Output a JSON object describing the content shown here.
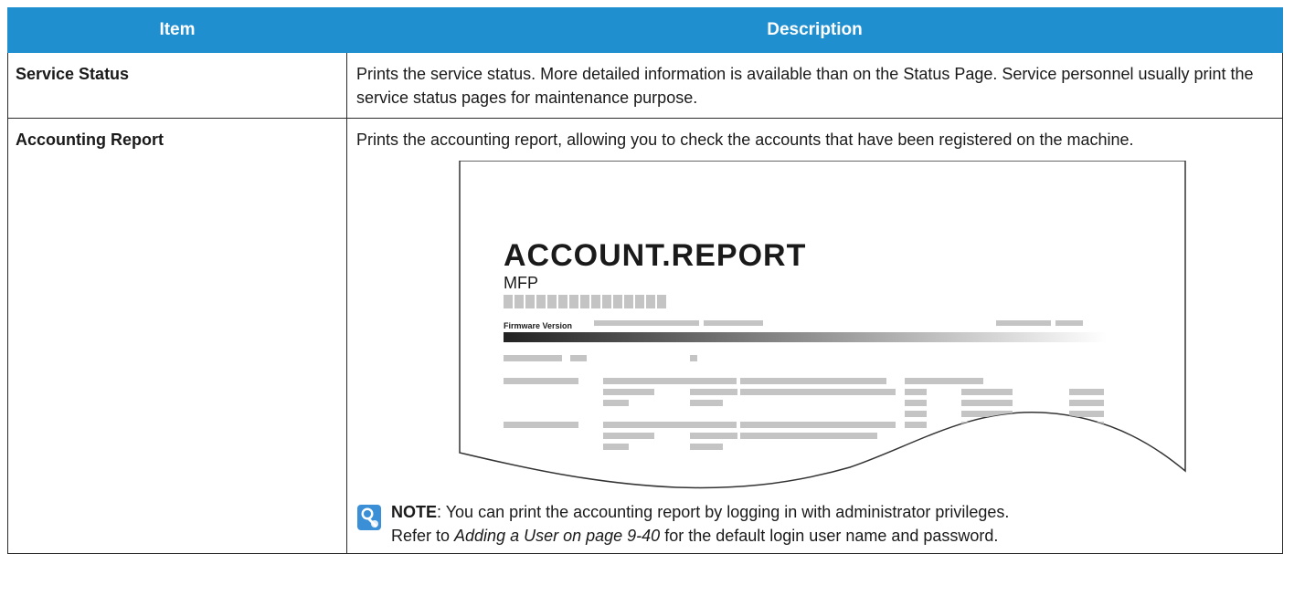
{
  "table": {
    "header": {
      "item": "Item",
      "description": "Description"
    },
    "rows": [
      {
        "item": "Service Status",
        "description": "Prints the service status. More detailed information is available than on the Status Page. Service personnel usually print the service status pages for maintenance purpose."
      },
      {
        "item": "Accounting Report",
        "description": "Prints the accounting report, allowing you to check the accounts that have been registered on the machine."
      }
    ]
  },
  "report": {
    "title": "ACCOUNT.REPORT",
    "subtitle": "MFP",
    "firmware_label": "Firmware Version"
  },
  "note": {
    "label": "NOTE",
    "line1_rest": ": You can print the accounting report by logging in with administrator privileges.",
    "line2_prefix": "Refer to ",
    "line2_link": "Adding a User on page 9-40",
    "line2_suffix": " for the default login user name and password.",
    "icon": "note-lightbulb-icon"
  },
  "colors": {
    "header_bg": "#1f8fd0",
    "header_text": "#ffffff"
  }
}
